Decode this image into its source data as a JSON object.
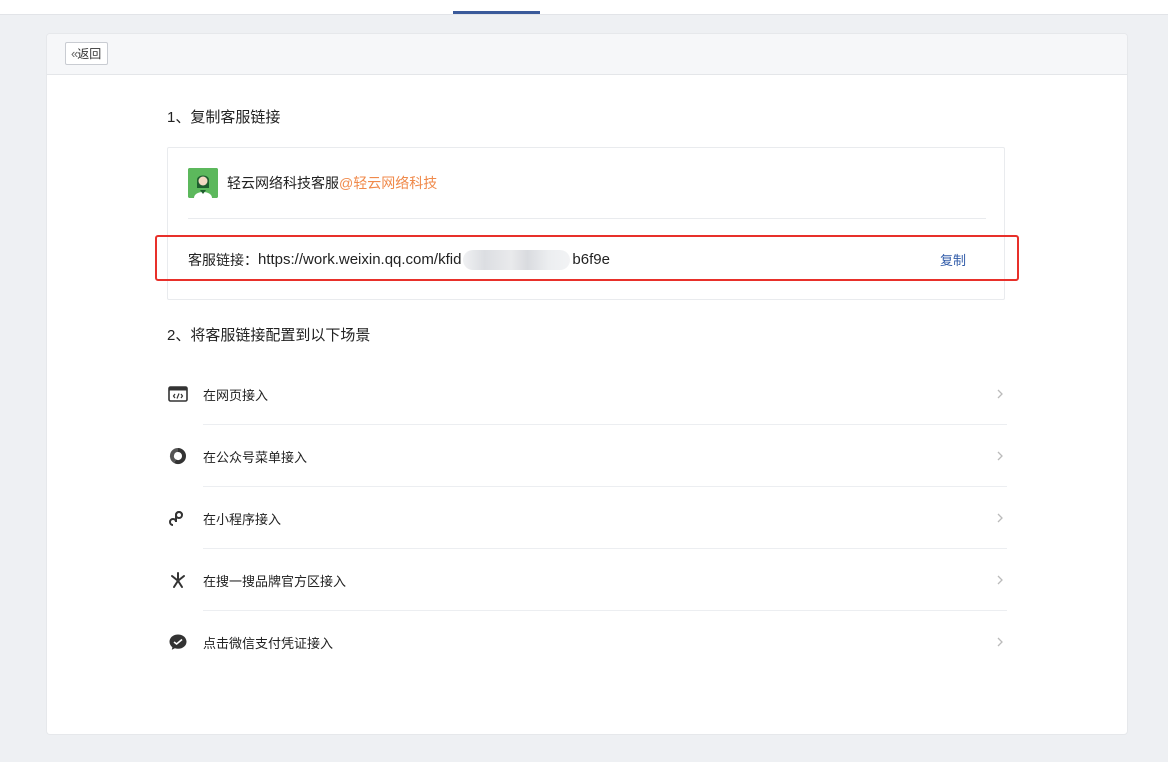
{
  "header": {
    "back_label": "返回"
  },
  "section1": {
    "title": "1、复制客服链接"
  },
  "kf": {
    "name": "轻云网络科技客服",
    "corp": "@轻云网络科技"
  },
  "link": {
    "label": "客服链接：",
    "url_prefix": "https://work.weixin.qq.com/kfid",
    "url_suffix": "b6f9e",
    "copy_label": "复制"
  },
  "section2": {
    "title": "2、将客服链接配置到以下场景"
  },
  "scenes": [
    {
      "label": "在网页接入",
      "icon": "webpage-code-icon"
    },
    {
      "label": "在公众号菜单接入",
      "icon": "official-account-icon"
    },
    {
      "label": "在小程序接入",
      "icon": "mini-program-icon"
    },
    {
      "label": "在搜一搜品牌官方区接入",
      "icon": "search-sparkle-icon"
    },
    {
      "label": "点击微信支付凭证接入",
      "icon": "wechat-pay-icon"
    }
  ],
  "colors": {
    "accent": "#2f5aa8",
    "corp_orange": "#f08a4b",
    "highlight_red": "#e8302a",
    "avatar_green": "#4caf50"
  }
}
